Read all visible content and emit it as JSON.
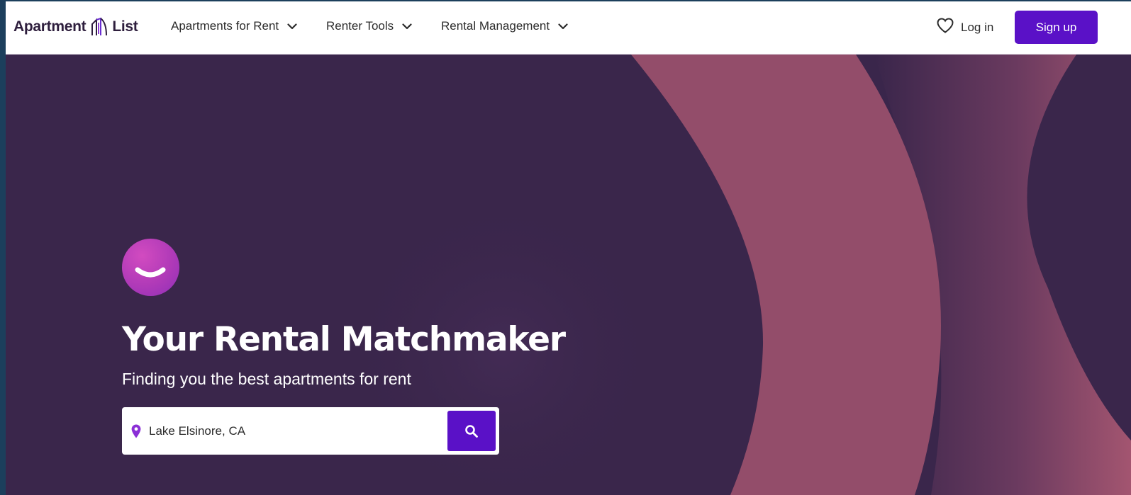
{
  "header": {
    "logo_text_left": "Apartment",
    "logo_text_right": "List",
    "nav": [
      {
        "label": "Apartments for Rent"
      },
      {
        "label": "Renter Tools"
      },
      {
        "label": "Rental Management"
      }
    ],
    "login_label": "Log in",
    "signup_label": "Sign up"
  },
  "hero": {
    "title": "Your Rental Matchmaker",
    "subtitle": "Finding you the best apartments for rent",
    "search": {
      "value": "Lake Elsinore, CA"
    }
  },
  "icons": {
    "logo_mark": "building-logo-icon",
    "nav_chevron": "chevron-down-icon",
    "favorites": "heart-icon",
    "location": "map-pin-icon",
    "search": "search-icon",
    "brand": "smile-icon"
  },
  "colors": {
    "primary": "#5a11c7",
    "hero_background": "#3a264b",
    "arc": "#934d6a",
    "text_dark": "#2c2c2c"
  }
}
